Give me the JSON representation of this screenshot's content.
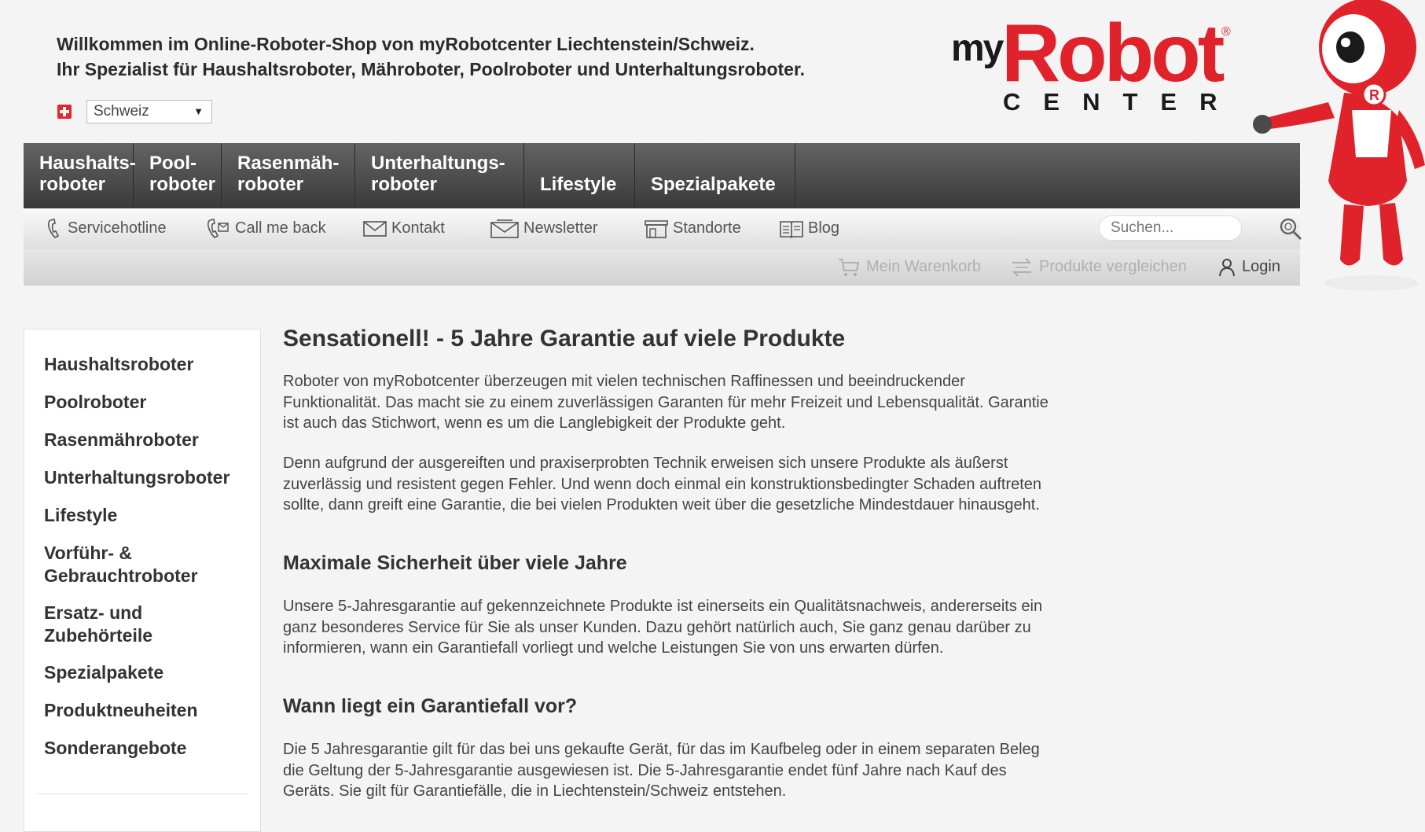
{
  "header": {
    "welcome_line1": "Willkommen im Online-Roboter-Shop von myRobotcenter Liechtenstein/Schweiz.",
    "welcome_line2": "Ihr Spezialist für Haushaltsroboter, Mähroboter, Poolroboter und Unterhaltungsroboter.",
    "country_selected": "Schweiz",
    "logo": {
      "my": "my",
      "robot": "Robot",
      "registered": "®",
      "center": "CENTER"
    }
  },
  "main_nav": [
    {
      "line1": "Haushalts-",
      "line2": "roboter"
    },
    {
      "line1": "Pool-",
      "line2": "roboter"
    },
    {
      "line1": "Rasenmäh-",
      "line2": "roboter"
    },
    {
      "line1": "Unterhaltungs-",
      "line2": "roboter"
    },
    {
      "line1": "",
      "line2": "Lifestyle"
    },
    {
      "line1": "",
      "line2": "Spezialpakete"
    }
  ],
  "toolbar": {
    "servicehotline": "Servicehotline",
    "callmeback": "Call me back",
    "kontakt": "Kontakt",
    "newsletter": "Newsletter",
    "standorte": "Standorte",
    "blog": "Blog",
    "search_placeholder": "Suchen..."
  },
  "subbar": {
    "cart": "Mein Warenkorb",
    "compare": "Produkte vergleichen",
    "login": "Login"
  },
  "sidebar": [
    "Haushaltsroboter",
    "Poolroboter",
    "Rasenmähroboter",
    "Unterhaltungsroboter",
    "Lifestyle",
    "Vorführ- &\nGebrauchtroboter",
    "Ersatz- und\nZubehörteile",
    "Spezialpakete",
    "Produktneuheiten",
    "Sonderangebote"
  ],
  "content": {
    "title": "Sensationell! - 5 Jahre Garantie auf viele Produkte",
    "p1": "Roboter von myRobotcenter überzeugen mit vielen technischen Raffinessen und beeindruckender Funktionalität. Das macht sie zu einem zuverlässigen Garanten für mehr Freizeit und Lebensqualität. Garantie ist auch das Stichwort, wenn es um die Langlebigkeit der Produkte geht.",
    "p2": "Denn aufgrund der ausgereiften und praxiserprobten Technik erweisen sich unsere Produkte als äußerst zuverlässig und resistent gegen Fehler. Und wenn doch einmal ein konstruktionsbedingter Schaden auftreten sollte, dann greift eine Garantie, die bei vielen Produkten weit über die gesetzliche Mindestdauer hinausgeht.",
    "h2a": "Maximale Sicherheit über viele Jahre",
    "p3": "Unsere 5-Jahresgarantie auf gekennzeichnete Produkte ist einerseits ein Qualitätsnachweis, andererseits ein ganz besonderes Service für Sie als unser Kunden. Dazu gehört natürlich auch, Sie ganz genau darüber zu informieren, wann ein Garantiefall vorliegt und welche Leistungen Sie von uns erwarten dürfen.",
    "h2b": "Wann liegt ein Garantiefall vor?",
    "p4": "Die 5 Jahresgarantie gilt für das bei uns gekaufte Gerät, für das im Kaufbeleg oder in einem separaten Beleg die Geltung der 5-Jahresgarantie ausgewiesen ist. Die 5-Jahresgarantie endet fünf Jahre nach Kauf des Geräts. Sie gilt für Garantiefälle, die in Liechtenstein/Schweiz entstehen."
  },
  "colors": {
    "brand_red": "#e0222b",
    "nav_dark": "#3a3a3a"
  }
}
